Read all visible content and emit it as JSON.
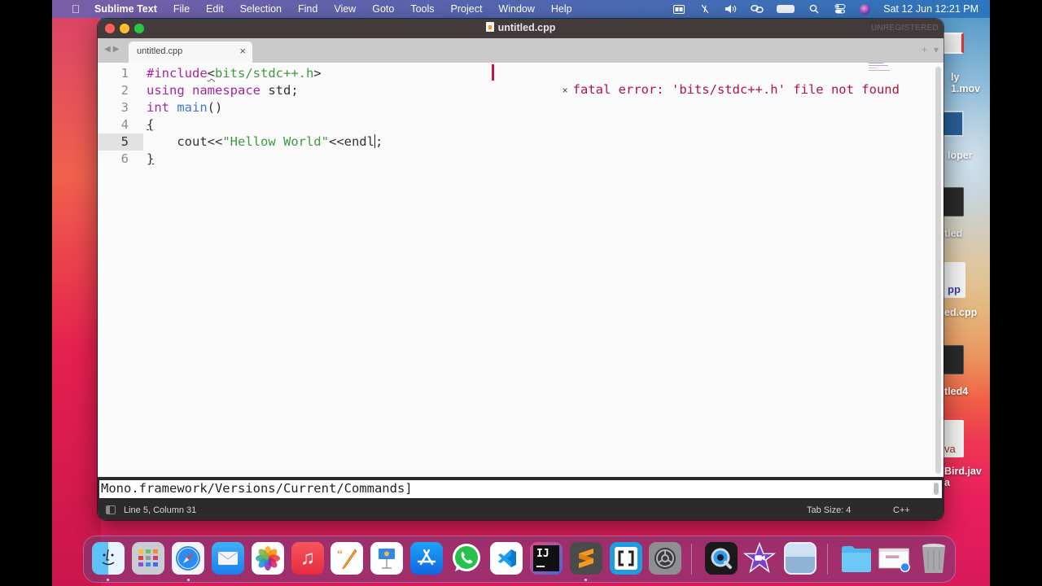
{
  "menubar": {
    "apple_icon": "apple-logo",
    "app_name": "Sublime Text",
    "menus": [
      "File",
      "Edit",
      "Selection",
      "Find",
      "View",
      "Goto",
      "Tools",
      "Project",
      "Window",
      "Help"
    ],
    "status_icons": [
      "menu-extra-icon",
      "mic-off-icon",
      "volume-icon",
      "link-icon",
      "battery-icon",
      "spotlight-icon",
      "control-center-icon",
      "siri-icon"
    ],
    "datetime": "Sat 12 Jun  12:21 PM"
  },
  "desktop": {
    "icons": [
      {
        "label_line1": "ly",
        "label_line2": "1.mov"
      },
      {
        "label_line1": "loper",
        "label_line2": ""
      },
      {
        "label_line1": "tled",
        "label_line2": ""
      },
      {
        "label_line1": "ed.cpp",
        "label_line2": "",
        "thumb_text": "pp"
      },
      {
        "label_line1": "tled4",
        "label_line2": ""
      },
      {
        "label_line1": "Bird.jav",
        "label_line2": "a",
        "thumb_text": "va"
      }
    ]
  },
  "window": {
    "title": "untitled.cpp",
    "unregistered": "UNREGISTERED",
    "tabs": [
      {
        "label": "untitled.cpp",
        "active": true
      }
    ],
    "tab_tools": {
      "add": "+",
      "menu": "▾"
    },
    "nav": {
      "back": "◀",
      "forward": "▶"
    }
  },
  "editor": {
    "active_line": 5,
    "lines": [
      {
        "n": "1",
        "tokens": [
          {
            "t": "#include",
            "c": "pp"
          },
          {
            "t": "<",
            "c": "squig"
          },
          {
            "t": "bits/stdc++.h",
            "c": "inc"
          },
          {
            "t": ">",
            "c": ""
          }
        ]
      },
      {
        "n": "2",
        "tokens": [
          {
            "t": "using",
            "c": "kw"
          },
          {
            "t": " ",
            "c": ""
          },
          {
            "t": "namespace",
            "c": "kw"
          },
          {
            "t": " std;",
            "c": ""
          }
        ]
      },
      {
        "n": "3",
        "tokens": [
          {
            "t": "int",
            "c": "kw"
          },
          {
            "t": " ",
            "c": ""
          },
          {
            "t": "main",
            "c": "fn"
          },
          {
            "t": "()",
            "c": ""
          }
        ]
      },
      {
        "n": "4",
        "tokens": [
          {
            "t": "{",
            "c": "brace-ul"
          }
        ]
      },
      {
        "n": "5",
        "tokens": [
          {
            "t": "    cout<<",
            "c": ""
          },
          {
            "t": "\"Hellow World\"",
            "c": "str"
          },
          {
            "t": "<<endl",
            "c": ""
          },
          {
            "t": "|cursor|",
            "c": "cursor"
          },
          {
            "t": ";",
            "c": ""
          }
        ]
      },
      {
        "n": "6",
        "tokens": [
          {
            "t": "}",
            "c": "brace-ul"
          }
        ]
      }
    ],
    "error_phantom": {
      "close_glyph": "×",
      "message": "fatal error: 'bits/stdc++.h' file not found"
    }
  },
  "console": {
    "text": "Mono.framework/Versions/Current/Commands]"
  },
  "statusbar": {
    "position": "Line 5, Column 31",
    "tab_size": "Tab Size: 4",
    "syntax": "C++"
  },
  "dock": {
    "apps": [
      {
        "name": "Finder",
        "running": true
      },
      {
        "name": "Launchpad",
        "running": false
      },
      {
        "name": "Safari",
        "running": true
      },
      {
        "name": "Mail",
        "running": false
      },
      {
        "name": "Photos",
        "running": false
      },
      {
        "name": "Music",
        "running": false
      },
      {
        "name": "Pages",
        "running": false
      },
      {
        "name": "Keynote",
        "running": false
      },
      {
        "name": "App Store",
        "running": false
      },
      {
        "name": "WhatsApp",
        "running": false
      },
      {
        "name": "Visual Studio Code",
        "running": false
      },
      {
        "name": "IntelliJ IDEA",
        "running": false,
        "glyph": "IJ"
      },
      {
        "name": "Sublime Text",
        "running": true
      },
      {
        "name": "Brackets",
        "running": false
      },
      {
        "name": "System Preferences",
        "running": false
      },
      {
        "name": "QuickTime Player",
        "running": false
      },
      {
        "name": "iMovie",
        "running": false
      },
      {
        "name": "Preview",
        "running": false
      },
      {
        "name": "Downloads",
        "running": false
      },
      {
        "name": "Recent Document",
        "running": false
      },
      {
        "name": "Trash",
        "running": false
      }
    ]
  }
}
